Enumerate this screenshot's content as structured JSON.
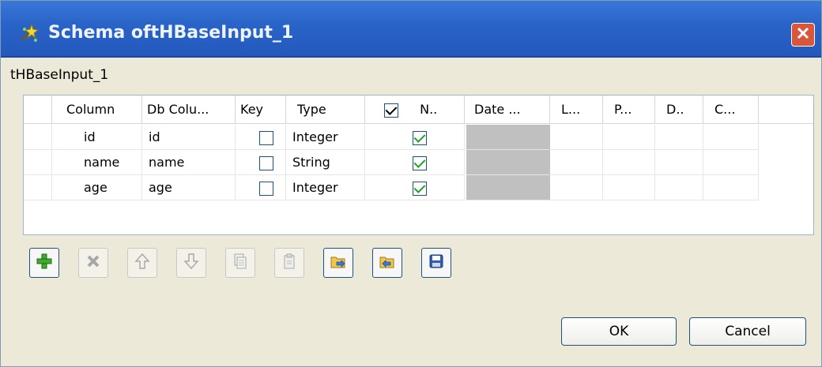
{
  "window": {
    "title": "Schema oftHBaseInput_1",
    "icon": "schema-wand-icon"
  },
  "component_label": "tHBaseInput_1",
  "table": {
    "columns": [
      "Column",
      "Db Colu...",
      "Key",
      "Type",
      "N..",
      "Date ...",
      "L...",
      "P...",
      "D..",
      "C..."
    ],
    "header_nullable_checked": true,
    "rows": [
      {
        "column": "id",
        "db_column": "id",
        "key": false,
        "type": "Integer",
        "nullable": true
      },
      {
        "column": "name",
        "db_column": "name",
        "key": false,
        "type": "String",
        "nullable": true
      },
      {
        "column": "age",
        "db_column": "age",
        "key": false,
        "type": "Integer",
        "nullable": true
      }
    ]
  },
  "toolbar": {
    "buttons": [
      {
        "name": "add-row-button",
        "icon": "plus-icon",
        "enabled": true
      },
      {
        "name": "delete-row-button",
        "icon": "x-icon",
        "enabled": false
      },
      {
        "name": "move-up-button",
        "icon": "arrow-up-icon",
        "enabled": false
      },
      {
        "name": "move-down-button",
        "icon": "arrow-down-icon",
        "enabled": false
      },
      {
        "name": "copy-button",
        "icon": "copy-icon",
        "enabled": false
      },
      {
        "name": "paste-button",
        "icon": "paste-icon",
        "enabled": false
      },
      {
        "name": "import-schema-button",
        "icon": "import-icon",
        "enabled": true
      },
      {
        "name": "export-schema-button",
        "icon": "export-icon",
        "enabled": true
      },
      {
        "name": "save-schema-button",
        "icon": "save-icon",
        "enabled": true
      }
    ]
  },
  "buttons": {
    "ok": "OK",
    "cancel": "Cancel"
  },
  "colors": {
    "titlebar": "#2a64c8",
    "dialog_bg": "#ece9d8",
    "date_cell": "#c0c0c0",
    "check": "#21a121"
  }
}
